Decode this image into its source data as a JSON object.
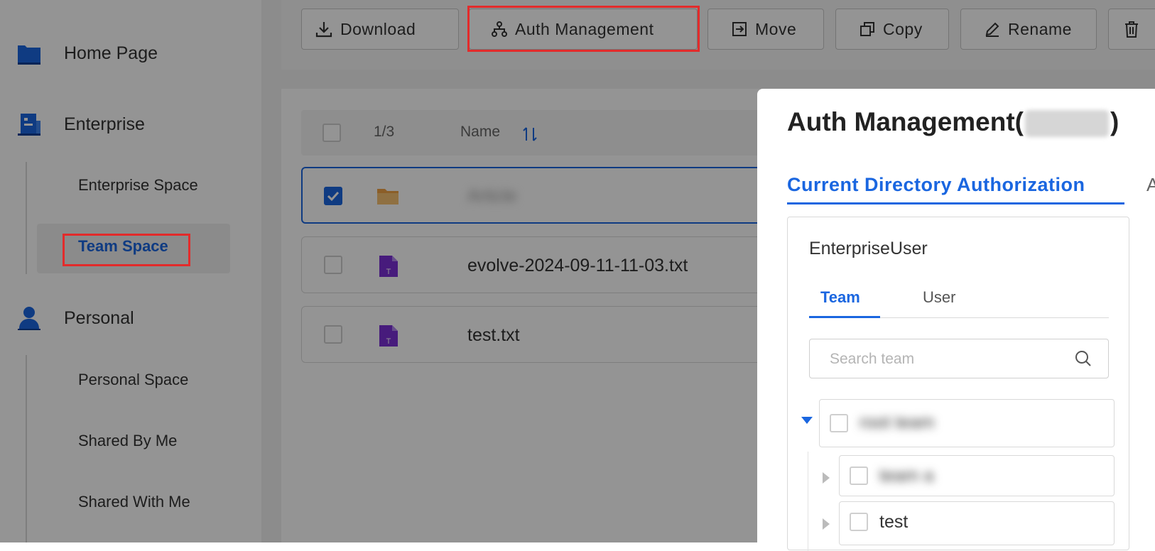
{
  "toolbar": {
    "download": "Download",
    "auth_management": "Auth Management",
    "move": "Move",
    "copy": "Copy",
    "rename": "Rename"
  },
  "sidebar": {
    "home_page": "Home Page",
    "enterprise": "Enterprise",
    "enterprise_space": "Enterprise Space",
    "team_space": "Team Space",
    "personal": "Personal",
    "personal_space": "Personal Space",
    "shared_by_me": "Shared By Me",
    "shared_with_me": "Shared With Me"
  },
  "file_list": {
    "selection_count": "1/3",
    "name_header": "Name",
    "rows": [
      {
        "name": "Article",
        "type": "folder",
        "checked": true
      },
      {
        "name": "evolve-2024-09-11-11-03.txt",
        "type": "txt",
        "checked": false
      },
      {
        "name": "test.txt",
        "type": "txt",
        "checked": false
      }
    ]
  },
  "modal": {
    "title_prefix": "Auth Management(",
    "title_suffix": ")",
    "tab_current": "Current Directory Authorization",
    "tab_more": "A",
    "card_title": "EnterpriseUser",
    "subtab_team": "Team",
    "subtab_user": "User",
    "search_placeholder": "Search team",
    "tree": [
      {
        "label": "root team",
        "level": 0,
        "expanded": true
      },
      {
        "label": "team a",
        "level": 1,
        "expanded": false
      },
      {
        "label": "test",
        "level": 1,
        "expanded": false
      }
    ]
  },
  "colors": {
    "accent": "#1a66e0",
    "highlight_box": "#e32b2b",
    "txt_icon": "#7b2fd6",
    "folder_icon": "#f0a345"
  }
}
